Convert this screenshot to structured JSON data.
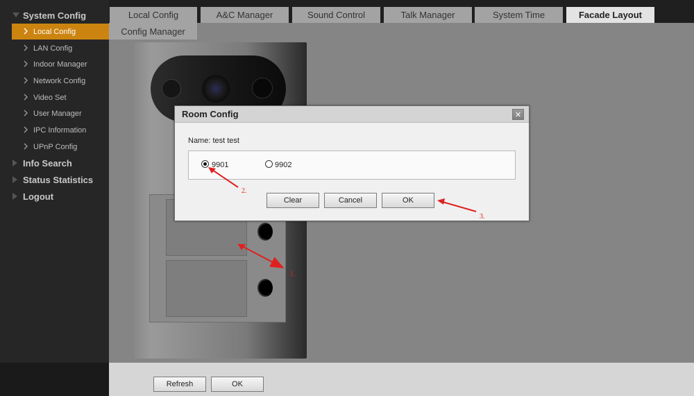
{
  "sidebar": {
    "groups": [
      {
        "label": "System Config"
      },
      {
        "label": "Info Search"
      },
      {
        "label": "Status Statistics"
      },
      {
        "label": "Logout"
      }
    ],
    "items": [
      {
        "label": "Local Config"
      },
      {
        "label": "LAN Config"
      },
      {
        "label": "Indoor Manager"
      },
      {
        "label": "Network Config"
      },
      {
        "label": "Video Set"
      },
      {
        "label": "User Manager"
      },
      {
        "label": "IPC Information"
      },
      {
        "label": "UPnP Config"
      }
    ]
  },
  "tabs": [
    {
      "label": "Local Config"
    },
    {
      "label": "A&C Manager"
    },
    {
      "label": "Sound Control"
    },
    {
      "label": "Talk Manager"
    },
    {
      "label": "System Time"
    },
    {
      "label": "Facade Layout"
    }
  ],
  "subtab": {
    "label": "Config Manager"
  },
  "dialog": {
    "title": "Room Config",
    "close_glyph": "✕",
    "name_label": "Name: test test",
    "options": [
      {
        "label": "9901",
        "checked": true
      },
      {
        "label": "9902",
        "checked": false
      }
    ],
    "buttons": {
      "clear": "Clear",
      "cancel": "Cancel",
      "ok": "OK"
    }
  },
  "bottom": {
    "refresh": "Refresh",
    "ok": "OK"
  },
  "annotations": [
    "1.",
    "2.",
    "3."
  ],
  "colors": {
    "accent": "#cc8410",
    "annotation": "#e02020"
  }
}
